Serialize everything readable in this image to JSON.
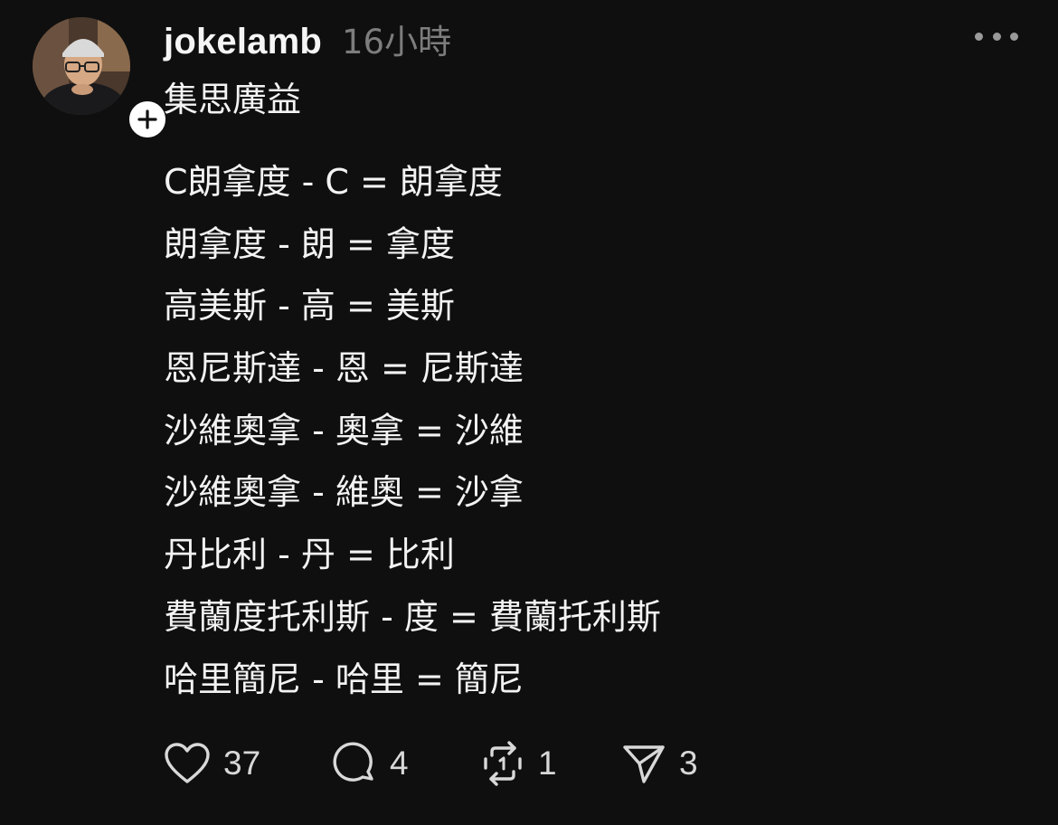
{
  "post": {
    "author": {
      "username": "jokelamb",
      "time": "16小時"
    },
    "first_line": "集思廣益",
    "lines": [
      "C朗拿度 - C = 朗拿度",
      "朗拿度 - 朗 = 拿度",
      "高美斯 - 高 = 美斯",
      "恩尼斯達 - 恩 = 尼斯達",
      "沙維奧拿 - 奧拿 = 沙維",
      "沙維奧拿 - 維奧 = 沙拿",
      "丹比利 - 丹 = 比利",
      "費蘭度托利斯 - 度 = 費蘭托利斯",
      "哈里簡尼 - 哈里 = 簡尼"
    ],
    "actions": {
      "likes": "37",
      "replies": "4",
      "reposts": "1",
      "shares": "3"
    }
  },
  "icons": {
    "more": "more-horizontal-icon",
    "follow": "plus-icon",
    "like": "heart-icon",
    "reply": "comment-bubble-icon",
    "repost": "repost-icon",
    "share": "send-icon"
  },
  "colors": {
    "background": "#0f0f0f",
    "text": "#f3f3f3",
    "muted": "#7d7d7d",
    "icon": "#d8d8d8"
  }
}
